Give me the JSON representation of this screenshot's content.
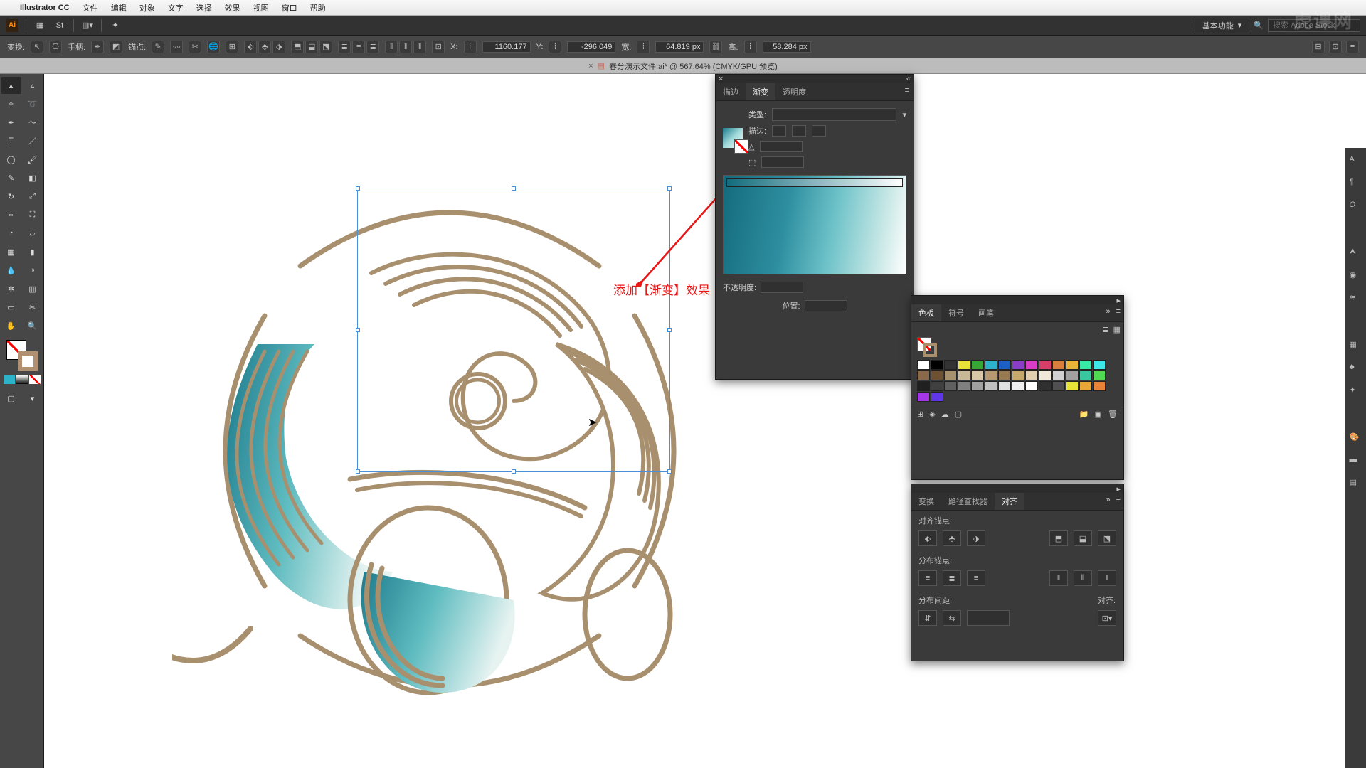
{
  "menubar": {
    "app": "Illustrator CC",
    "items": [
      "文件",
      "编辑",
      "对象",
      "文字",
      "选择",
      "效果",
      "视图",
      "窗口",
      "帮助"
    ]
  },
  "appbar": {
    "workspace": "基本功能",
    "search_placeholder": "搜索 Adobe Stock"
  },
  "controlbar": {
    "transform": "变换:",
    "handle": "手柄:",
    "anchor": "锚点:",
    "x_label": "X:",
    "x": "1160.177",
    "y_label": "Y:",
    "y": "-296.049",
    "w_label": "宽:",
    "w": "64.819 px",
    "h_label": "高:",
    "h": "58.284 px"
  },
  "document": {
    "title": "春分演示文件.ai* @ 567.64% (CMYK/GPU 预览)"
  },
  "gradient_panel": {
    "tabs": [
      "描边",
      "渐变",
      "透明度"
    ],
    "active": 1,
    "type_label": "类型:",
    "stroke_label": "描边:",
    "opacity_label": "不透明度:",
    "position_label": "位置:"
  },
  "swatches_panel": {
    "tabs": [
      "色板",
      "符号",
      "画笔"
    ],
    "active": 0,
    "colors": [
      "#ffffff",
      "#000000",
      "#333333",
      "#e8e337",
      "#37a637",
      "#2db3c9",
      "#1e5fc6",
      "#8a3dc6",
      "#d93dc6",
      "#d93d6a",
      "#d97f3d",
      "#e8b337",
      "#37e8a6",
      "#3de8e8",
      "#8a694a",
      "#6e5130",
      "#a8926e",
      "#c8b896",
      "#d8c8a6",
      "#b89870",
      "#987850",
      "#c5a86a",
      "#e0d0b0",
      "#f0e8d8",
      "#d0d0d0",
      "#a0a0a0",
      "#38c8a0",
      "#50d850",
      "#202020",
      "#404040",
      "#606060",
      "#808080",
      "#a0a0a0",
      "#c0c0c0",
      "#e0e0e0",
      "#f0f0f0",
      "#ffffff",
      "#303030",
      "#505050",
      "#e8e337",
      "#e8a637",
      "#e88337",
      "#a637e8",
      "#5f37e8"
    ]
  },
  "align_panel": {
    "tabs": [
      "变换",
      "路径查找器",
      "对齐"
    ],
    "active": 2,
    "align_anchor": "对齐锚点:",
    "dist_anchor": "分布锚点:",
    "dist_spacing": "分布间距:",
    "align_to": "对齐:"
  },
  "annotation": "添加【渐变】效果",
  "watermark": "虎课网"
}
